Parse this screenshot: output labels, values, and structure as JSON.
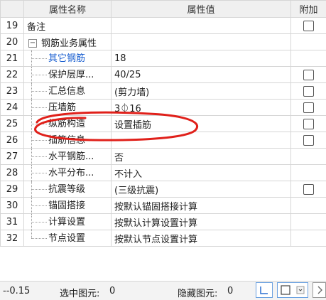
{
  "header": {
    "name": "属性名称",
    "value": "属性值",
    "extra": "附加"
  },
  "rows": [
    {
      "num": "19",
      "name": "备注",
      "value": "",
      "checkbox": true
    },
    {
      "num": "20",
      "name": "钢筋业务属性",
      "value": "",
      "checkbox": false,
      "expander": "−"
    },
    {
      "num": "21",
      "name": "其它钢筋",
      "value": "18",
      "checkbox": false
    },
    {
      "num": "22",
      "name": "保护层厚...",
      "value": "40/25",
      "checkbox": true
    },
    {
      "num": "23",
      "name": "汇总信息",
      "value": "(剪力墙)",
      "checkbox": true
    },
    {
      "num": "24",
      "name": "压墙筋",
      "value": "3⏀16",
      "checkbox": true
    },
    {
      "num": "25",
      "name": "纵筋构造",
      "value": "设置插筋",
      "checkbox": true
    },
    {
      "num": "26",
      "name": "插筋信息",
      "value": "",
      "checkbox": true
    },
    {
      "num": "27",
      "name": "水平钢筋...",
      "value": "否",
      "checkbox": false
    },
    {
      "num": "28",
      "name": "水平分布...",
      "value": "不计入",
      "checkbox": false
    },
    {
      "num": "29",
      "name": "抗震等级",
      "value": "(三级抗震)",
      "checkbox": true
    },
    {
      "num": "30",
      "name": "锚固搭接",
      "value": "按默认锚固搭接计算",
      "checkbox": false
    },
    {
      "num": "31",
      "name": "计算设置",
      "value": "按默认计算设置计算",
      "checkbox": false
    },
    {
      "num": "32",
      "name": "节点设置",
      "value": "按默认节点设置计算",
      "checkbox": false
    }
  ],
  "status": {
    "coord": "--0.15",
    "selected_label": "选中图元:",
    "selected_count": "0",
    "hidden_label": "隐藏图元:",
    "hidden_count": "0"
  },
  "colors": {
    "annotation": "#e0201a",
    "link": "#1a5fd0"
  }
}
